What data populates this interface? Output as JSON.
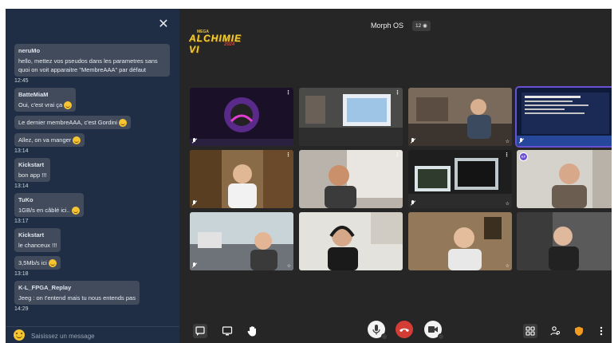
{
  "chat": {
    "groups": [
      {
        "sender": "neruMo",
        "messages": [
          {
            "text": "hello, mettez vos pseudos dans les parametres sans quoi on voit apparaitre \"MembreAAA\" par défaut",
            "emoji": false
          }
        ],
        "time": "12:45"
      },
      {
        "sender": "BatteMiaM",
        "messages": [
          {
            "text": "Oui, c'est vrai ça",
            "emoji": true
          },
          {
            "text": "Le dernier membreAAA, c'est Gordini",
            "emoji": true
          },
          {
            "text": "Allez, on va manger",
            "emoji": true
          }
        ],
        "time": "13:14"
      },
      {
        "sender": "Kickstart",
        "messages": [
          {
            "text": "bon app !!!",
            "emoji": false
          }
        ],
        "time": "13:14"
      },
      {
        "sender": "TuKo",
        "messages": [
          {
            "text": "1GB/s en câblé ici..",
            "emoji": true
          }
        ],
        "time": "13:17"
      },
      {
        "sender": "Kickstart",
        "messages": [
          {
            "text": "le chanceux !!!",
            "emoji": false
          },
          {
            "text": "3,5Mb/s ici",
            "emoji": true
          }
        ],
        "time": "13:18"
      },
      {
        "sender": "K-L_FPGA_Replay",
        "messages": [
          {
            "text": "Jeeg : on t'entend mais tu nous entends pas",
            "emoji": false
          }
        ],
        "time": "14:29"
      }
    ],
    "input_placeholder": "Saisissez un message"
  },
  "header": {
    "room_name": "Morph OS",
    "participant_count": "12",
    "logo_small": "MEGA",
    "logo_main": "ALCHIMIE VI",
    "logo_sub": "2024"
  },
  "tiles": [
    {
      "name": "tile-1",
      "muted": true,
      "star": false,
      "menu": true,
      "active": false,
      "scene": "desktop-purple"
    },
    {
      "name": "tile-2",
      "muted": false,
      "star": false,
      "menu": true,
      "active": false,
      "scene": "room-monitor"
    },
    {
      "name": "tile-3",
      "muted": true,
      "star": true,
      "menu": false,
      "active": false,
      "scene": "person-desk"
    },
    {
      "name": "tile-4",
      "muted": true,
      "star": true,
      "menu": false,
      "active": true,
      "scene": "code-screen"
    },
    {
      "name": "tile-5",
      "muted": true,
      "star": false,
      "menu": true,
      "active": false,
      "scene": "person-shelves"
    },
    {
      "name": "tile-6",
      "muted": false,
      "star": false,
      "menu": true,
      "active": false,
      "scene": "person-window"
    },
    {
      "name": "tile-7",
      "muted": true,
      "star": true,
      "menu": true,
      "active": false,
      "scene": "monitors"
    },
    {
      "name": "tile-8",
      "muted": false,
      "star": false,
      "menu": false,
      "active": false,
      "scene": "person-avatar",
      "avatar": "KF"
    },
    {
      "name": "tile-9",
      "muted": true,
      "star": true,
      "menu": false,
      "active": false,
      "scene": "person-room"
    },
    {
      "name": "tile-10",
      "muted": false,
      "star": false,
      "menu": false,
      "active": false,
      "scene": "person-headphones"
    },
    {
      "name": "tile-11",
      "muted": false,
      "star": true,
      "menu": false,
      "active": false,
      "scene": "person-bookcase"
    },
    {
      "name": "tile-12",
      "muted": false,
      "star": false,
      "menu": false,
      "active": false,
      "scene": "person-dark"
    }
  ],
  "colors": {
    "chat_bg": "#1f2e45",
    "bubble": "#414b5c",
    "hangup": "#d33d36",
    "accent": "#6a50d3",
    "shield": "#f39c1f"
  },
  "toolbar": {
    "left": [
      "chat-icon",
      "screen-share-icon",
      "raise-hand-icon"
    ],
    "center": [
      "microphone-icon",
      "hangup-icon",
      "camera-icon"
    ],
    "right": [
      "tile-view-icon",
      "participants-icon",
      "security-shield-icon",
      "more-icon"
    ]
  }
}
